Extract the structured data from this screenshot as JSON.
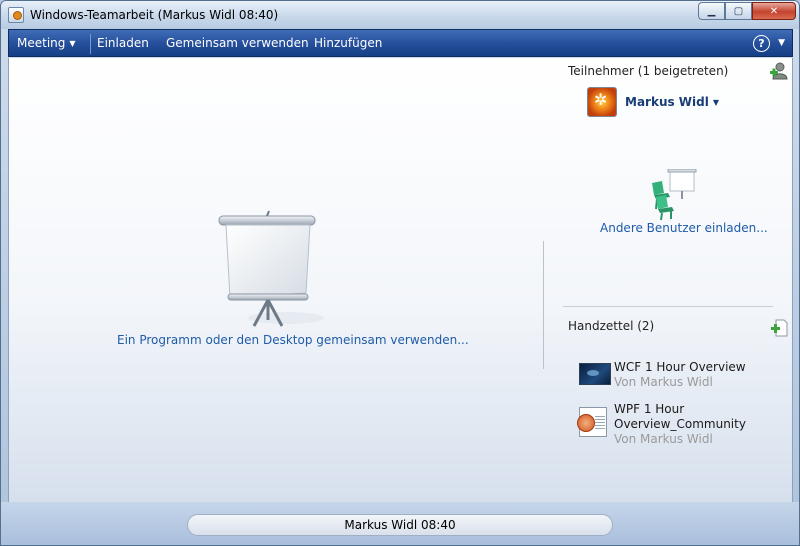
{
  "window": {
    "title": "Windows-Teamarbeit (Markus Widl 08:40)"
  },
  "menu": {
    "meeting": "Meeting",
    "invite": "Einladen",
    "share": "Gemeinsam verwenden",
    "add": "Hinzufügen",
    "help": "?"
  },
  "main": {
    "share_link": "Ein Programm oder den Desktop gemeinsam verwenden..."
  },
  "participants": {
    "header": "Teilnehmer (1 beigetreten)",
    "items": [
      {
        "name": "Markus Widl"
      }
    ],
    "invite_link": "Andere Benutzer einladen..."
  },
  "handouts": {
    "header": "Handzettel (2)",
    "items": [
      {
        "title": "WCF 1 Hour Overview",
        "author": "Von Markus Widl"
      },
      {
        "title_line1": "WPF 1 Hour",
        "title_line2": "Overview_Community",
        "author": "Von Markus Widl"
      }
    ]
  },
  "status": {
    "text": "Markus Widl 08:40"
  },
  "colors": {
    "menubar": "#26509c",
    "link": "#1f5ba8",
    "participant_name": "#1a3f78",
    "muted_text": "#9a9a9a",
    "close_button": "#c4432f"
  },
  "icons": {
    "app": "collaboration-app-icon",
    "help": "help-icon",
    "add_participant": "add-person-icon",
    "add_handout": "add-file-icon",
    "projector": "projector-screen-icon",
    "invite": "chairs-and-screen-icon"
  }
}
